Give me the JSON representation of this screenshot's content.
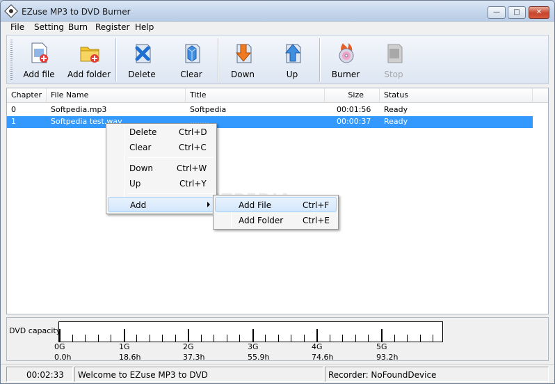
{
  "window": {
    "title": "EZuse MP3 to DVD Burner"
  },
  "menu": [
    "File",
    "Setting",
    "Burn",
    "Register",
    "Help"
  ],
  "toolbar": {
    "add_file": "Add file",
    "add_folder": "Add folder",
    "delete": "Delete",
    "clear": "Clear",
    "down": "Down",
    "up": "Up",
    "burner": "Burner",
    "stop": "Stop"
  },
  "list": {
    "columns": [
      "Chapter",
      "File Name",
      "Title",
      "Size",
      "Status"
    ],
    "rows": [
      {
        "chapter": "0",
        "file": "Softpedia.mp3",
        "title": "Softpedia",
        "size": "00:01:56",
        "status": "Ready"
      },
      {
        "chapter": "1",
        "file": "Softpedia test.wav",
        "title": "........",
        "size": "00:00:37",
        "status": "Ready"
      }
    ]
  },
  "context_menu": {
    "delete": {
      "label": "Delete",
      "key": "Ctrl+D"
    },
    "clear": {
      "label": "Clear",
      "key": "Ctrl+C"
    },
    "down": {
      "label": "Down",
      "key": "Ctrl+W"
    },
    "up": {
      "label": "Up",
      "key": "Ctrl+Y"
    },
    "add": {
      "label": "Add"
    }
  },
  "submenu": {
    "add_file": {
      "label": "Add File",
      "key": "Ctrl+F"
    },
    "add_folder": {
      "label": "Add Folder",
      "key": "Ctrl+E"
    }
  },
  "capacity": {
    "label": "DVD capacity:",
    "gb": [
      "0G",
      "1G",
      "2G",
      "3G",
      "4G",
      "5G"
    ],
    "hours": [
      "0.0h",
      "18.6h",
      "37.3h",
      "55.9h",
      "74.6h",
      "93.2h"
    ]
  },
  "status": {
    "time": "00:02:33",
    "message": "Welcome to EZuse MP3 to DVD",
    "recorder": "Recorder: NoFoundDevice"
  },
  "watermark": "SOFTPEDIA"
}
